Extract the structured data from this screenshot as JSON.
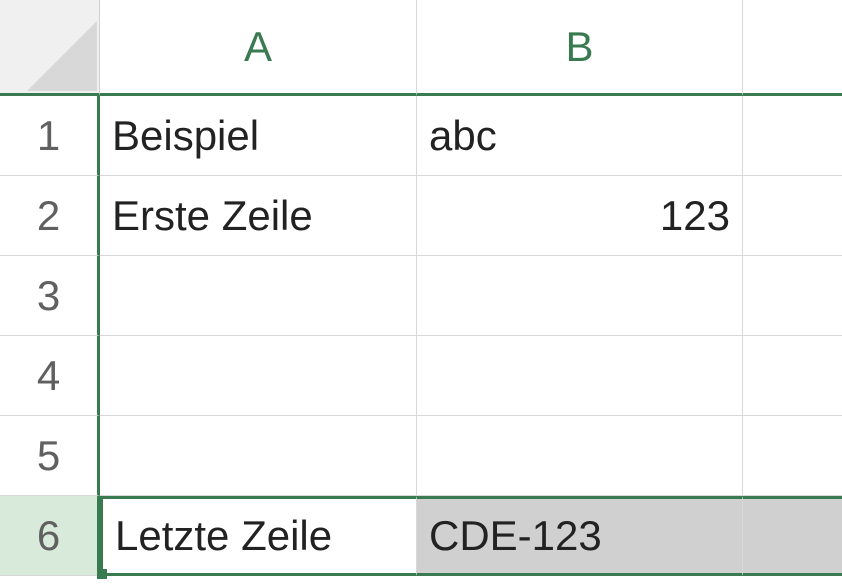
{
  "columns": [
    "A",
    "B"
  ],
  "rowNumbers": [
    "1",
    "2",
    "3",
    "4",
    "5",
    "6"
  ],
  "selectedRow": 6,
  "cells": {
    "A1": "Beispiel",
    "B1": "abc",
    "A2": "Erste Zeile",
    "B2": "123",
    "A3": "",
    "B3": "",
    "A4": "",
    "B4": "",
    "A5": "",
    "B5": "",
    "A6": "Letzte Zeile",
    "B6": "CDE-123"
  }
}
